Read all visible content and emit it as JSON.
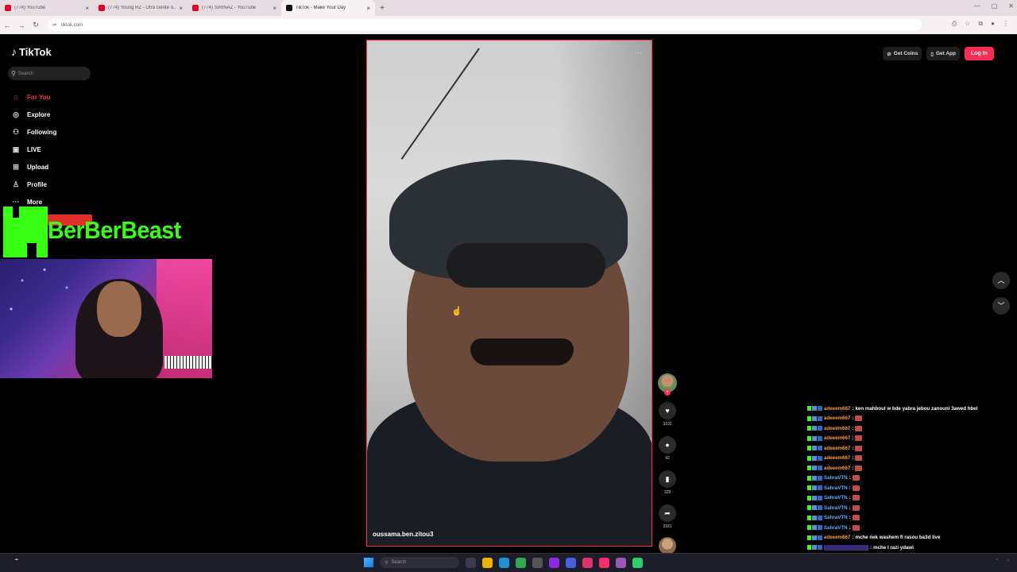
{
  "browser": {
    "tabs": [
      {
        "title": "(774) YouTube",
        "active": false
      },
      {
        "title": "(774) Young RZ - Otra Gente ó...",
        "active": false
      },
      {
        "title": "(774) SIRINAZ - YouTube",
        "active": false
      },
      {
        "title": "TikTok - Make Your Day",
        "active": true
      }
    ],
    "new_tab": "+",
    "url": "tiktok.com"
  },
  "tiktok": {
    "logo": "TikTok",
    "search_placeholder": "Search",
    "menu": [
      {
        "label": "For You",
        "icon": "home-icon",
        "active": true
      },
      {
        "label": "Explore",
        "icon": "compass-icon",
        "active": false
      },
      {
        "label": "Following",
        "icon": "person-icon",
        "active": false
      },
      {
        "label": "LIVE",
        "icon": "live-icon",
        "active": false
      },
      {
        "label": "Upload",
        "icon": "plus-square-icon",
        "active": false
      },
      {
        "label": "Profile",
        "icon": "user-icon",
        "active": false
      },
      {
        "label": "More",
        "icon": "more-icon",
        "active": false
      }
    ],
    "get_coins": "Get Coins",
    "get_app": "Get App",
    "login": "Log In",
    "video": {
      "username": "oussama.ben.zitou3",
      "likes": "3192",
      "comments": "92",
      "saves": "328",
      "shares": "2181"
    }
  },
  "overlay": {
    "brand_text": "BerBerBeast"
  },
  "chat": [
    {
      "user": "adeeem667",
      "color": "orange",
      "msg": "ken mahboul w bde yabra jebou zanouni 3awed hbel",
      "emote": false
    },
    {
      "user": "adeeem667",
      "color": "orange",
      "msg": "",
      "emote": true
    },
    {
      "user": "adeeem667",
      "color": "orange",
      "msg": "",
      "emote": true
    },
    {
      "user": "adeeem667",
      "color": "orange",
      "msg": "",
      "emote": true
    },
    {
      "user": "adeeem667",
      "color": "orange",
      "msg": "",
      "emote": true
    },
    {
      "user": "adeeem667",
      "color": "orange",
      "msg": "",
      "emote": true
    },
    {
      "user": "adeeem667",
      "color": "orange",
      "msg": "",
      "emote": true
    },
    {
      "user": "SahraVTN",
      "color": "blue",
      "msg": "",
      "emote": true
    },
    {
      "user": "SahraVTN",
      "color": "blue",
      "msg": "",
      "emote": true
    },
    {
      "user": "SahraVTN",
      "color": "blue",
      "msg": "",
      "emote": true
    },
    {
      "user": "SahraVTN",
      "color": "blue",
      "msg": "",
      "emote": true
    },
    {
      "user": "SahraVTN",
      "color": "blue",
      "msg": "",
      "emote": true
    },
    {
      "user": "SahraVTN",
      "color": "blue",
      "msg": "",
      "emote": true
    },
    {
      "user": "adeeem667",
      "color": "orange",
      "msg": "mche nek washem fi rasou ba3d live",
      "emote": false
    },
    {
      "user": "",
      "color": "purple",
      "msg": "mche l razi ydawi",
      "emote": false
    }
  ],
  "taskbar": {
    "search_placeholder": "Search"
  },
  "colors": {
    "accent": "#fe2c55",
    "brand_green": "#39ff14"
  }
}
